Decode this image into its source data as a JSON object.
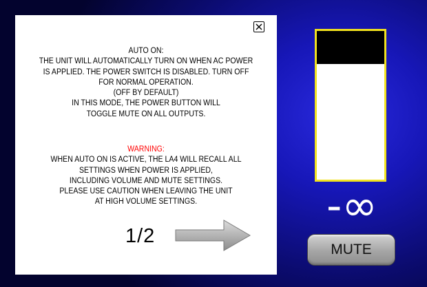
{
  "dialog": {
    "close_symbol": "X",
    "auto_on": {
      "lines": [
        "AUTO ON:",
        "THE UNIT WILL AUTOMATICALLY TURN ON WHEN AC POWER",
        "IS APPLIED. THE POWER SWITCH IS DISABLED. TURN OFF",
        "FOR NORMAL OPERATION.",
        "(OFF BY DEFAULT)",
        "IN THIS MODE, THE POWER BUTTON WILL",
        "TOGGLE MUTE ON ALL OUTPUTS."
      ]
    },
    "warning": {
      "heading": "WARNING:",
      "lines": [
        "WHEN AUTO ON IS ACTIVE, THE LA4 WILL RECALL ALL",
        "SETTINGS WHEN POWER IS APPLIED,",
        "INCLUDING VOLUME AND MUTE SETTINGS.",
        "PLEASE USE CAUTION WHEN LEAVING THE UNIT",
        "AT HIGH VOLUME SETTINGS."
      ]
    },
    "page_indicator": "1/2",
    "next_icon": "right-arrow-icon"
  },
  "volume": {
    "meter_level": 0.78,
    "meter_border_color": "#f2e21e",
    "readout": "-∞"
  },
  "mute_button": {
    "label": "MUTE"
  },
  "colors": {
    "background": "#1515b0",
    "warning": "#ff0000"
  }
}
